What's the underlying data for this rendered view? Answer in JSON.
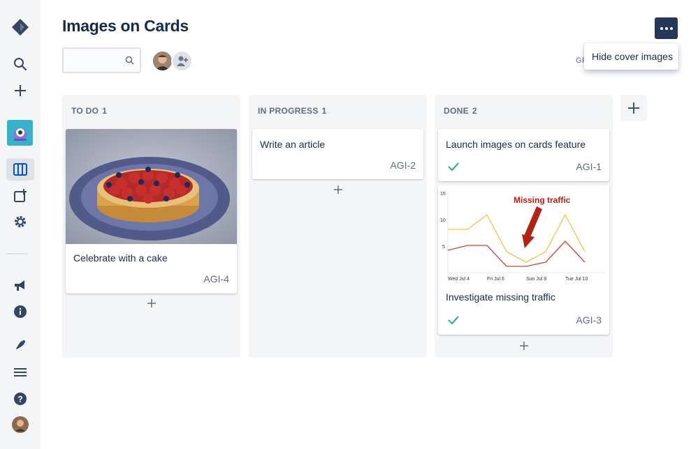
{
  "page": {
    "title": "Images on Cards"
  },
  "header": {
    "more_menu_item": "Hide cover images",
    "group_label_partial": "GR",
    "search": {
      "value": "",
      "placeholder": ""
    }
  },
  "nav": {
    "items": [
      "jira-logo-icon",
      "search-icon",
      "create-icon",
      "project-avatar",
      "board-icon",
      "add-item-icon",
      "settings-icon",
      "announcements-icon",
      "info-icon",
      "feedback-icon",
      "menu-icon",
      "help-icon",
      "profile-avatar"
    ]
  },
  "columns": [
    {
      "name": "TO DO",
      "count": "1",
      "cards": [
        {
          "title": "Celebrate with a cake",
          "key": "AGI-4",
          "cover": "cake-photo",
          "done": false
        }
      ]
    },
    {
      "name": "IN PROGRESS",
      "count": "1",
      "cards": [
        {
          "title": "Write an article",
          "key": "AGI-2",
          "done": false
        }
      ]
    },
    {
      "name": "DONE",
      "count": "2",
      "cards": [
        {
          "title": "Launch images on cards feature",
          "key": "AGI-1",
          "done": true
        },
        {
          "title": "Investigate missing traffic",
          "key": "AGI-3",
          "cover": "traffic-chart",
          "done": true
        }
      ]
    }
  ],
  "cover_chart": {
    "annotation": "Missing traffic",
    "y_ticks": [
      "15",
      "10",
      "5"
    ],
    "x_ticks": [
      "Wed Jul 4",
      "Fri Jul 6",
      "Sun Jul 8",
      "Tue Jul 10"
    ]
  },
  "colors": {
    "accent": "#253858",
    "done_check": "#36b37e",
    "column_bg": "#f4f5f7",
    "chart_line_yellow": "#f6c342",
    "chart_line_red": "#d04437",
    "annotation_red": "#c9190b"
  }
}
